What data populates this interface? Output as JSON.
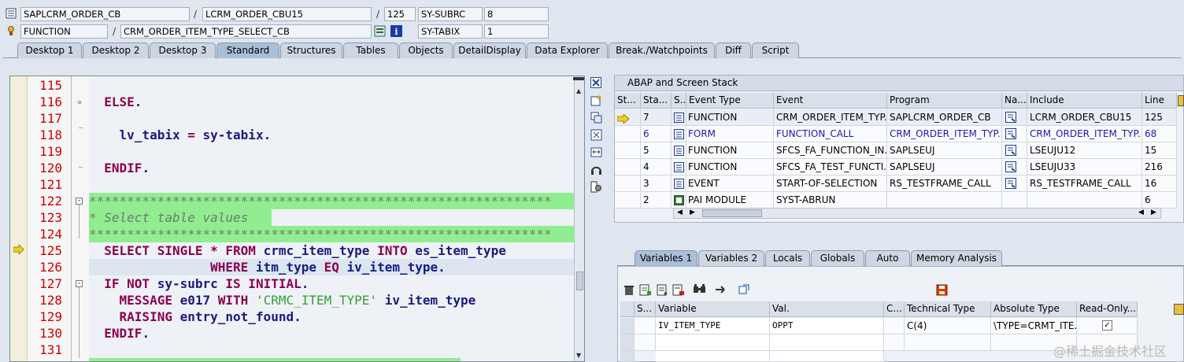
{
  "header": {
    "row1": {
      "program": "SAPLCRM_ORDER_CB",
      "include": "LCRM_ORDER_CBU15",
      "line": "125",
      "sysvar": "SY-SUBRC",
      "sysvalue": "8"
    },
    "row2": {
      "type": "FUNCTION",
      "name": "CRM_ORDER_ITEM_TYPE_SELECT_CB",
      "sysvar": "SY-TABIX",
      "sysvalue": "1"
    },
    "sep": "/"
  },
  "tabs": [
    "Desktop 1",
    "Desktop 2",
    "Desktop 3",
    "Standard",
    "Structures",
    "Tables",
    "Objects",
    "DetailDisplay",
    "Data Explorer",
    "Break./Watchpoints",
    "Diff",
    "Script"
  ],
  "active_tab": "Standard",
  "code": {
    "line_numbers": [
      "115",
      "116",
      "117",
      "118",
      "119",
      "120",
      "121",
      "122",
      "123",
      "124",
      "125",
      "126",
      "127",
      "128",
      "129",
      "130",
      "131"
    ],
    "current_line": "125"
  },
  "stack": {
    "title": "ABAP and Screen Stack",
    "columns": [
      "St...",
      "Sta...",
      "S...",
      "Event Type",
      "Event",
      "Program",
      "Na...",
      "Include",
      "Line"
    ],
    "rows": [
      {
        "level": "7",
        "type": "FUNCTION",
        "event": "CRM_ORDER_ITEM_TYP...",
        "program": "SAPLCRM_ORDER_CB",
        "include": "LCRM_ORDER_CBU15",
        "line": "125"
      },
      {
        "level": "6",
        "type": "FORM",
        "event": "FUNCTION_CALL",
        "program": "CRM_ORDER_ITEM_TYP...",
        "include": "CRM_ORDER_ITEM_TYP...",
        "line": "68"
      },
      {
        "level": "5",
        "type": "FUNCTION",
        "event": "SFCS_FA_FUNCTION_IN...",
        "program": "SAPLSEUJ",
        "include": "LSEUJU12",
        "line": "15"
      },
      {
        "level": "4",
        "type": "FUNCTION",
        "event": "SFCS_FA_TEST_FUNCTI...",
        "program": "SAPLSEUJ",
        "include": "LSEUJU33",
        "line": "216"
      },
      {
        "level": "3",
        "type": "EVENT",
        "event": "START-OF-SELECTION",
        "program": "RS_TESTFRAME_CALL",
        "include": "RS_TESTFRAME_CALL",
        "line": "16"
      },
      {
        "level": "2",
        "type": "PAI MODULE",
        "event": "SYST-ABRUN",
        "program": "",
        "include": "",
        "line": "6"
      }
    ]
  },
  "var_tabs": [
    "Variables 1",
    "Variables 2",
    "Locals",
    "Globals",
    "Auto",
    "Memory Analysis"
  ],
  "variables": {
    "columns": [
      "S...",
      "Variable",
      "Val.",
      "C...",
      "Technical Type",
      "Absolute Type",
      "Read-Only..."
    ],
    "rows": [
      {
        "variable": "IV_ITEM_TYPE",
        "value": "OPPT",
        "technical": "C(4)",
        "absolute": "\\TYPE=CRMT_ITE..."
      }
    ]
  },
  "watermark": "@稀土掘金技术社区"
}
